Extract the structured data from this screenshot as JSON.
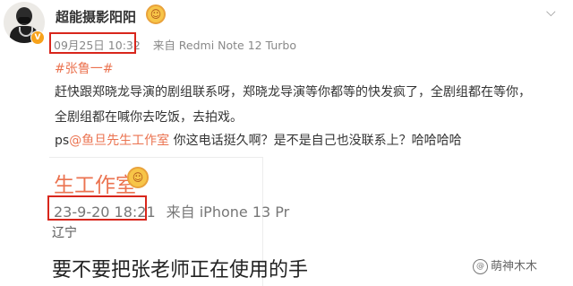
{
  "post": {
    "author": {
      "name": "超能摄影阳阳",
      "verified_badge": "V",
      "avatar_icon": "avatar"
    },
    "timestamp": "09月25日 10:32",
    "source": "来自 Redmi Note 12 Turbo",
    "topic": "#张鲁一#",
    "body_lines": [
      "赶快跟郑晓龙导演的剧组联系呀，郑晓龙导演等你都等的快发疯了，全剧组都在等你，",
      "全剧组都在喊你去吃饭，去拍戏。"
    ],
    "reply": {
      "prefix": "ps",
      "mention": "@鱼旦先生工作室",
      "text": " 你这电话挺久啊？是不是自己也没联系上？哈哈哈哈"
    }
  },
  "embedded": {
    "title": "生工作室",
    "timestamp": "23-9-20 18:21",
    "source": "来自 iPhone 13 Pr",
    "location": "辽宁",
    "text": "要不要把张老师正在使用的手"
  },
  "watermark": {
    "icon": "@",
    "text": "萌神木木"
  },
  "colors": {
    "accent": "#eb7350",
    "highlight_box": "#d8261c",
    "badge": "#f7a21b"
  }
}
